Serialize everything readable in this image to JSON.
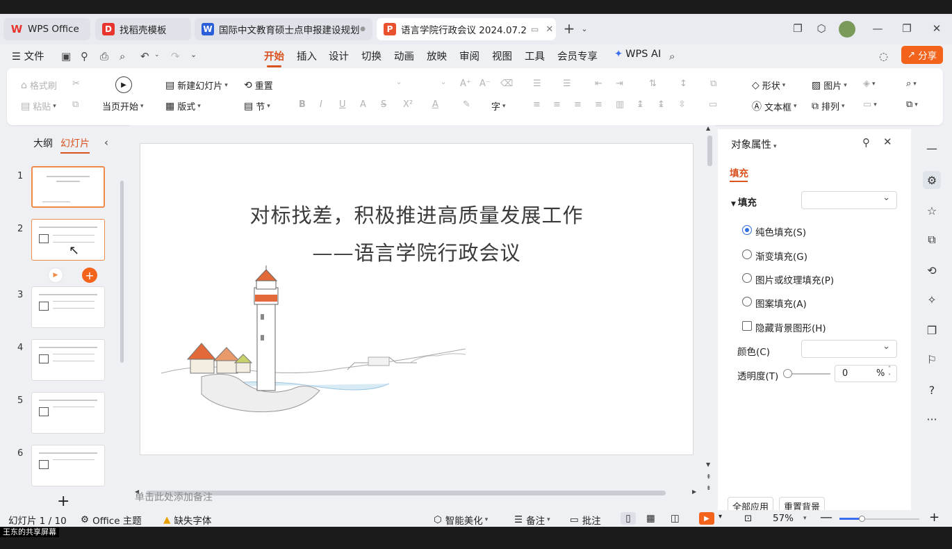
{
  "tabs": [
    {
      "label": "WPS Office",
      "icon": "wps-logo-icon",
      "color": "#e8352e"
    },
    {
      "label": "找稻壳模板",
      "icon": "docer-icon",
      "color": "#e8352e"
    },
    {
      "label": "国际中文教育硕士点申报建设规划",
      "icon": "word-icon",
      "color": "#2b5fd9"
    },
    {
      "label": "语言学院行政会议 2024.07.2",
      "icon": "ppt-icon",
      "color": "#e8522e"
    }
  ],
  "menu": {
    "file": "文件",
    "items": [
      "开始",
      "插入",
      "设计",
      "切换",
      "动画",
      "放映",
      "审阅",
      "视图",
      "工具",
      "会员专享"
    ],
    "active": "开始",
    "wps_ai": "WPS AI",
    "share": "分享"
  },
  "ribbon": {
    "format_painter": "格式刷",
    "paste": "粘贴",
    "play_from_current": "当页开始",
    "new_slide": "新建幻灯片",
    "layout": "版式",
    "reset": "重置",
    "section": "节",
    "shape": "形状",
    "picture": "图片",
    "textbox": "文本框",
    "arrange": "排列"
  },
  "left_pane": {
    "outline_tab": "大纲",
    "slides_tab": "幻灯片",
    "slide_numbers": [
      "1",
      "2",
      "3",
      "4",
      "5",
      "6"
    ],
    "add_slide": "+"
  },
  "slide": {
    "title": "对标找差，积极推进高质量发展工作",
    "subtitle": "——语言学院行政会议"
  },
  "notes_placeholder": "单击此处添加备注",
  "properties": {
    "title": "对象属性",
    "fill_tab": "填充",
    "fill_section": "填充",
    "options": [
      "纯色填充(S)",
      "渐变填充(G)",
      "图片或纹理填充(P)",
      "图案填充(A)"
    ],
    "selected_option": "纯色填充(S)",
    "hide_bg": "隐藏背景图形(H)",
    "color_label": "颜色(C)",
    "transparency_label": "透明度(T)",
    "transparency_value": "0",
    "transparency_unit": "%",
    "apply_all": "全部应用",
    "reset_bg": "重置背景"
  },
  "status": {
    "slide_count": "幻灯片 1 / 10",
    "theme": "Office 主题",
    "missing_font": "缺失字体",
    "smart_beautify": "智能美化",
    "notes": "备注",
    "comments": "批注",
    "zoom": "57%"
  },
  "screen_share_caption": "王东的共享屏幕",
  "colors": {
    "accent": "#d9531e",
    "share": "#f3631b",
    "selection": "#f08a4b"
  }
}
